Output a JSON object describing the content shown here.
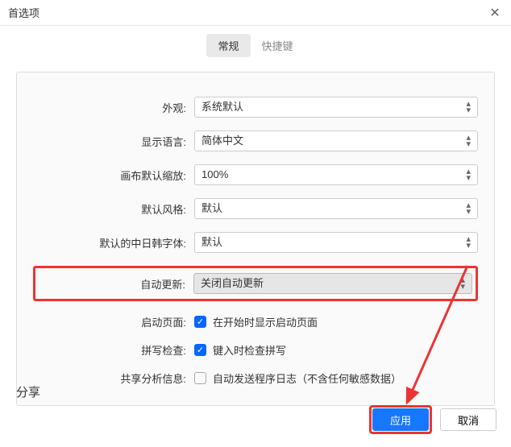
{
  "window": {
    "title": "首选项"
  },
  "tabs": {
    "general": "常规",
    "shortcuts": "快捷键"
  },
  "form": {
    "appearance": {
      "label": "外观:",
      "value": "系统默认"
    },
    "language": {
      "label": "显示语言:",
      "value": "简体中文"
    },
    "canvas_zoom": {
      "label": "画布默认缩放:",
      "value": "100%"
    },
    "default_style": {
      "label": "默认风格:",
      "value": "默认"
    },
    "cjk_font": {
      "label": "默认的中日韩字体:",
      "value": "默认"
    },
    "auto_update": {
      "label": "自动更新:",
      "value": "关闭自动更新"
    },
    "start_page": {
      "label": "启动页面:",
      "text": "在开始时显示启动页面",
      "checked": true
    },
    "spell_check": {
      "label": "拼写检查:",
      "text": "键入时检查拼写",
      "checked": true
    },
    "analytics": {
      "label": "共享分析信息:",
      "text": "自动发送程序日志（不含任何敏感数据）",
      "checked": false
    }
  },
  "sections": {
    "share": "分享"
  },
  "footer": {
    "apply": "应用",
    "cancel": "取消"
  }
}
